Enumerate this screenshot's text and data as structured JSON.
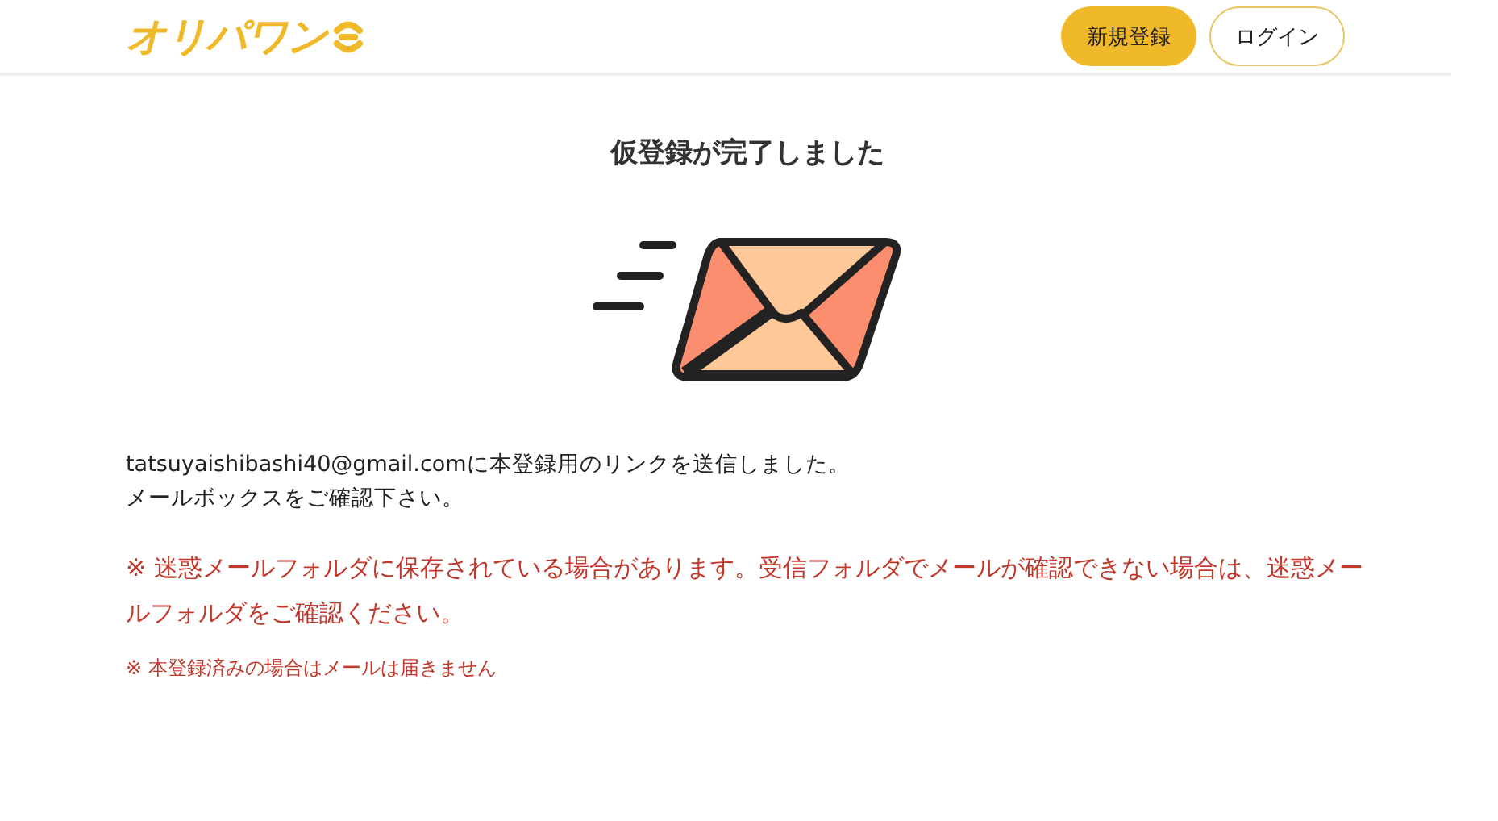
{
  "header": {
    "logo": "オリパワン",
    "buttons": [
      {
        "label": "新規登録",
        "kind": "primary"
      },
      {
        "label": "ログイン",
        "kind": "outline"
      }
    ]
  },
  "title": "仮登録が完了しました",
  "message": [
    "tatsuyaishibashi40@gmail.comに本登録用のリンクを送信しました。",
    "メールボックスをご確認下さい。"
  ],
  "warning": "※ 迷惑メールフォルダに保存されている場合があります。受信フォルダでメールが確認できない場合は、迷惑メールフォルダをご確認ください。",
  "note": "※ 本登録済みの場合はメールは届きません"
}
